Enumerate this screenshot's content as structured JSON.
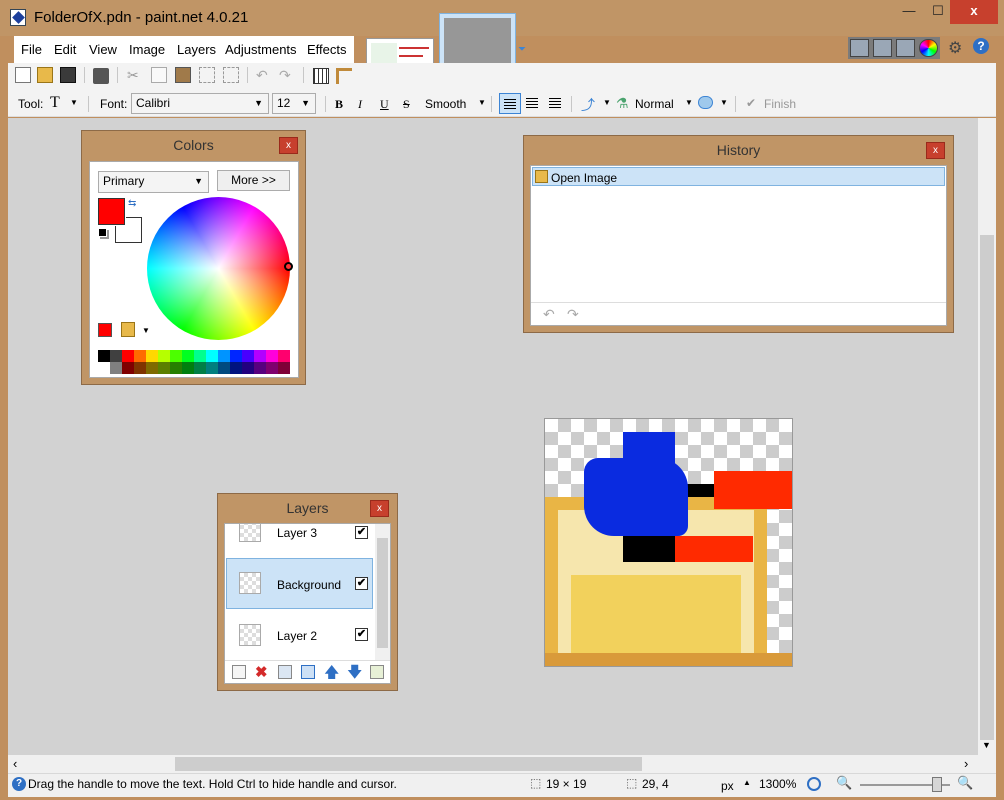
{
  "window": {
    "title": "FolderOfX.pdn - paint.net 4.0.21",
    "close_label": "x",
    "min_label": "—",
    "max_label": "☐"
  },
  "menu": {
    "items": [
      {
        "label": "File"
      },
      {
        "label": "Edit"
      },
      {
        "label": "View"
      },
      {
        "label": "Image"
      },
      {
        "label": "Layers"
      },
      {
        "label": "Adjustments"
      },
      {
        "label": "Effects"
      }
    ]
  },
  "toolbar2": {
    "tool_label": "Tool:",
    "font_label": "Font:",
    "font_value": "Calibri",
    "font_size": "12",
    "bold": "B",
    "italic": "I",
    "underline": "U",
    "strike": "S",
    "antialias": "Smooth",
    "blend": "Normal",
    "finish": "Finish"
  },
  "colors_panel": {
    "title": "Colors",
    "close": "x",
    "mode": "Primary",
    "more": "More >>",
    "primary_color": "#ff0000",
    "secondary_color": "#ffffff",
    "palette_top": [
      "#000000",
      "#404040",
      "#ff0000",
      "#ff6a00",
      "#ffd800",
      "#b6ff00",
      "#4cff00",
      "#00ff21",
      "#00ff90",
      "#00ffff",
      "#0094ff",
      "#0026ff",
      "#4800ff",
      "#b200ff",
      "#ff00dc",
      "#ff006e"
    ],
    "palette_bottom": [
      "#ffffff",
      "#808080",
      "#7f0000",
      "#7f3300",
      "#7f6a00",
      "#5b7f00",
      "#267f00",
      "#007f0e",
      "#007f46",
      "#007f7f",
      "#004a7f",
      "#00137f",
      "#21007f",
      "#57007f",
      "#7f006e",
      "#7f0037"
    ]
  },
  "history_panel": {
    "title": "History",
    "close": "x",
    "items": [
      {
        "label": "Open Image"
      }
    ]
  },
  "layers_panel": {
    "title": "Layers",
    "close": "x",
    "layers": [
      {
        "name": "Layer 3",
        "visible": "✔"
      },
      {
        "name": "Background",
        "visible": "✔"
      },
      {
        "name": "Layer 2",
        "visible": "✔"
      }
    ]
  },
  "status": {
    "hint": "Drag the handle to move the text. Hold Ctrl to hide handle and cursor.",
    "size": "19 × 19",
    "cursor": "29, 4",
    "units": "px",
    "zoom": "1300%"
  }
}
